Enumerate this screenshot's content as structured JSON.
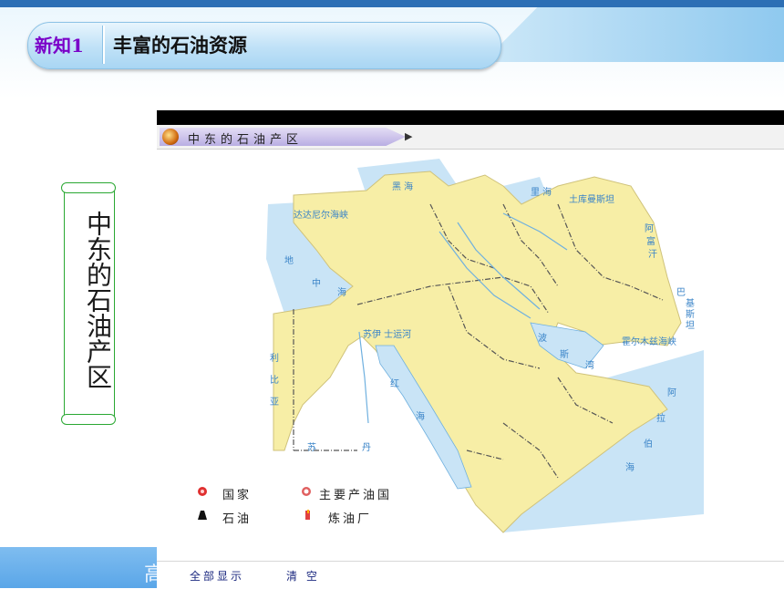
{
  "slide": {
    "tag": "新知1",
    "title": "丰富的石油资源",
    "side_label": "中东的石油产区",
    "bottom_char": "高"
  },
  "map_window": {
    "tab_title": "中东的石油产区",
    "footer": {
      "show_all": "全部显示",
      "clear": "清 空"
    },
    "legend": [
      {
        "icon": "country-marker-icon",
        "label": "国家"
      },
      {
        "icon": "major-oil-country-icon",
        "label": "主要产油国"
      },
      {
        "icon": "oil-well-icon",
        "label": "石油"
      },
      {
        "icon": "refinery-icon",
        "label": "炼油厂"
      }
    ],
    "labels": {
      "black_sea": "黑 海",
      "caspian": "里 海",
      "med_1": "地",
      "med_2": "中",
      "med_3": "海",
      "turkmen": "土库曼斯坦",
      "afghan_1": "阿",
      "afghan_2": "富",
      "afghan_3": "汗",
      "pakistan_1": "巴",
      "pakistan_2": "基",
      "pakistan_3": "斯",
      "pakistan_4": "坦",
      "suez": "苏伊 士运河",
      "gulf_1": "波",
      "gulf_2": "斯",
      "gulf_3": "湾",
      "hormuz": "霍尔木兹海峡",
      "red_sea_1": "红",
      "red_sea_2": "海",
      "libya_1": "利",
      "libya_2": "比",
      "libya_3": "亚",
      "sudan_1": "苏",
      "sudan_2": "丹",
      "arabian_1": "阿",
      "arabian_2": "拉",
      "arabian_3": "伯",
      "arabian_4": "海",
      "dardanelles": "达达尼尔海峡"
    }
  },
  "colors": {
    "land": "#f7eea6",
    "water": "#c9e4f6",
    "river": "#6fb0df",
    "border": "#555555",
    "tag": "#7a00c8",
    "scroll_border": "#2aa832"
  }
}
